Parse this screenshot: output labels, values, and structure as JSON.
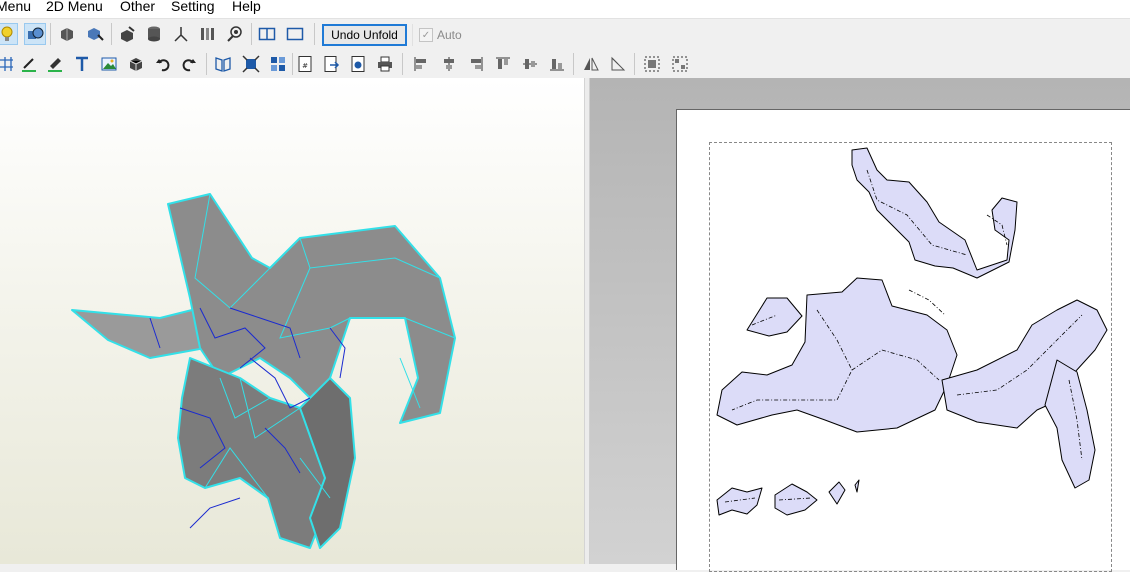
{
  "menubar": {
    "items": [
      {
        "label": "Menu"
      },
      {
        "label": "2D Menu"
      },
      {
        "label": "Other"
      },
      {
        "label": "Setting"
      },
      {
        "label": "Help"
      }
    ]
  },
  "toolbar": {
    "undo_unfold_label": "Undo Unfold",
    "auto_label": "Auto",
    "auto_checked": true
  },
  "colors": {
    "model_fill": "#8c8c8c",
    "model_edge": "#33e0e8",
    "fold_line": "#1b2bd0",
    "part_fill": "#dcdcf8",
    "part_outline": "#000000"
  },
  "icons": {
    "row1": [
      "lightbulb-icon",
      "model-view-icon",
      "rotate-part-icon",
      "select-part-icon",
      "knife-icon",
      "cylinder-icon",
      "axis-icon",
      "bars-icon",
      "eye-icon",
      "split-view-icon",
      "single-view-icon"
    ],
    "row2": [
      "grid-settings-icon",
      "pen-icon",
      "paint-icon",
      "text-icon",
      "image-icon",
      "box-icon",
      "undo-icon",
      "redo-icon",
      "book-icon",
      "fit-icon",
      "layout-icon",
      "page-number-icon",
      "export-icon",
      "print-preview-icon",
      "print-icon",
      "align-left-icon",
      "align-center-icon",
      "align-right-icon",
      "align-top-icon",
      "align-middle-icon",
      "align-bottom-icon",
      "flip-horizontal-icon",
      "flip-vertical-icon",
      "group-icon",
      "ungroup-icon"
    ]
  }
}
